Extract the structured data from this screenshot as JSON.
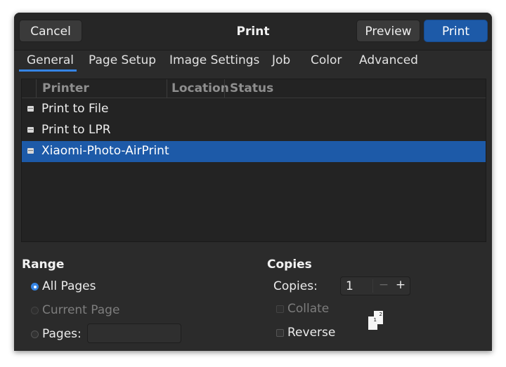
{
  "header": {
    "title": "Print",
    "cancel_label": "Cancel",
    "preview_label": "Preview",
    "print_label": "Print"
  },
  "tabs": [
    "General",
    "Page Setup",
    "Image Settings",
    "Job",
    "Color",
    "Advanced"
  ],
  "active_tab": "General",
  "printer_list": {
    "columns": [
      "Printer",
      "Location",
      "Status"
    ],
    "rows": [
      {
        "name": "Print to File",
        "icon": "printer-icon",
        "selected": false
      },
      {
        "name": "Print to LPR",
        "icon": "printer-icon",
        "selected": false
      },
      {
        "name": "Xiaomi-Photo-AirPrint",
        "icon": "printer-icon",
        "selected": true
      }
    ]
  },
  "range": {
    "title": "Range",
    "all_pages": "All Pages",
    "current_page": "Current Page",
    "pages": "Pages:",
    "pages_value": "",
    "selected": "All Pages"
  },
  "copies": {
    "title": "Copies",
    "copies_label": "Copies:",
    "copies_value": "1",
    "minus": "−",
    "plus": "+",
    "collate": "Collate",
    "reverse": "Reverse",
    "collate_preview": [
      "1",
      "2"
    ]
  },
  "colors": {
    "accent": "#1d5aa8",
    "background": "#2b2b2b"
  }
}
